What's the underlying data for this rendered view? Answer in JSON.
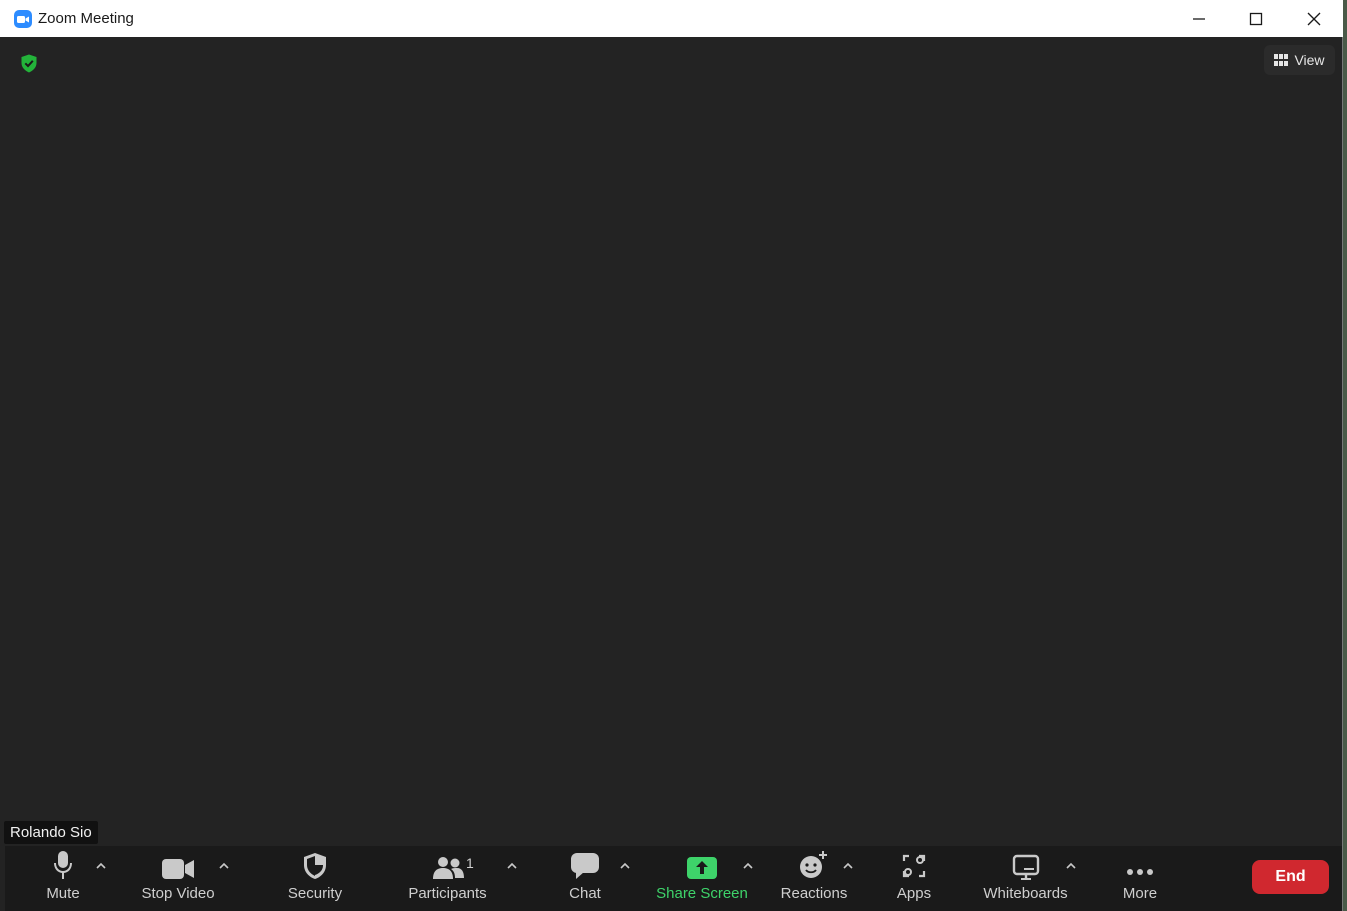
{
  "window": {
    "title": "Zoom Meeting"
  },
  "stage": {
    "view_label": "View",
    "participant_name": "Rolando Sio"
  },
  "toolbar": {
    "mute": "Mute",
    "stop_video": "Stop Video",
    "security": "Security",
    "participants": "Participants",
    "participants_count": "1",
    "chat": "Chat",
    "share_screen": "Share Screen",
    "reactions": "Reactions",
    "apps": "Apps",
    "whiteboards": "Whiteboards",
    "more": "More",
    "end": "End"
  },
  "icons": {
    "app": "zoom-camera-icon",
    "minimize": "minimize-icon",
    "maximize": "maximize-icon",
    "close": "close-icon",
    "encryption": "shield-check-icon",
    "view": "grid-icon",
    "mute": "microphone-icon",
    "video": "video-camera-icon",
    "security": "shield-icon",
    "participants": "people-icon",
    "chat": "chat-bubble-icon",
    "share": "share-arrow-icon",
    "reactions": "emoji-plus-icon",
    "apps": "apps-icon",
    "whiteboards": "whiteboard-icon",
    "more": "more-dots-icon",
    "caret": "chevron-up-icon"
  },
  "colors": {
    "share_green": "#3ed36a",
    "end_red": "#d0282f",
    "zoom_blue": "#2d8cff",
    "shield_green": "#23b33a"
  }
}
